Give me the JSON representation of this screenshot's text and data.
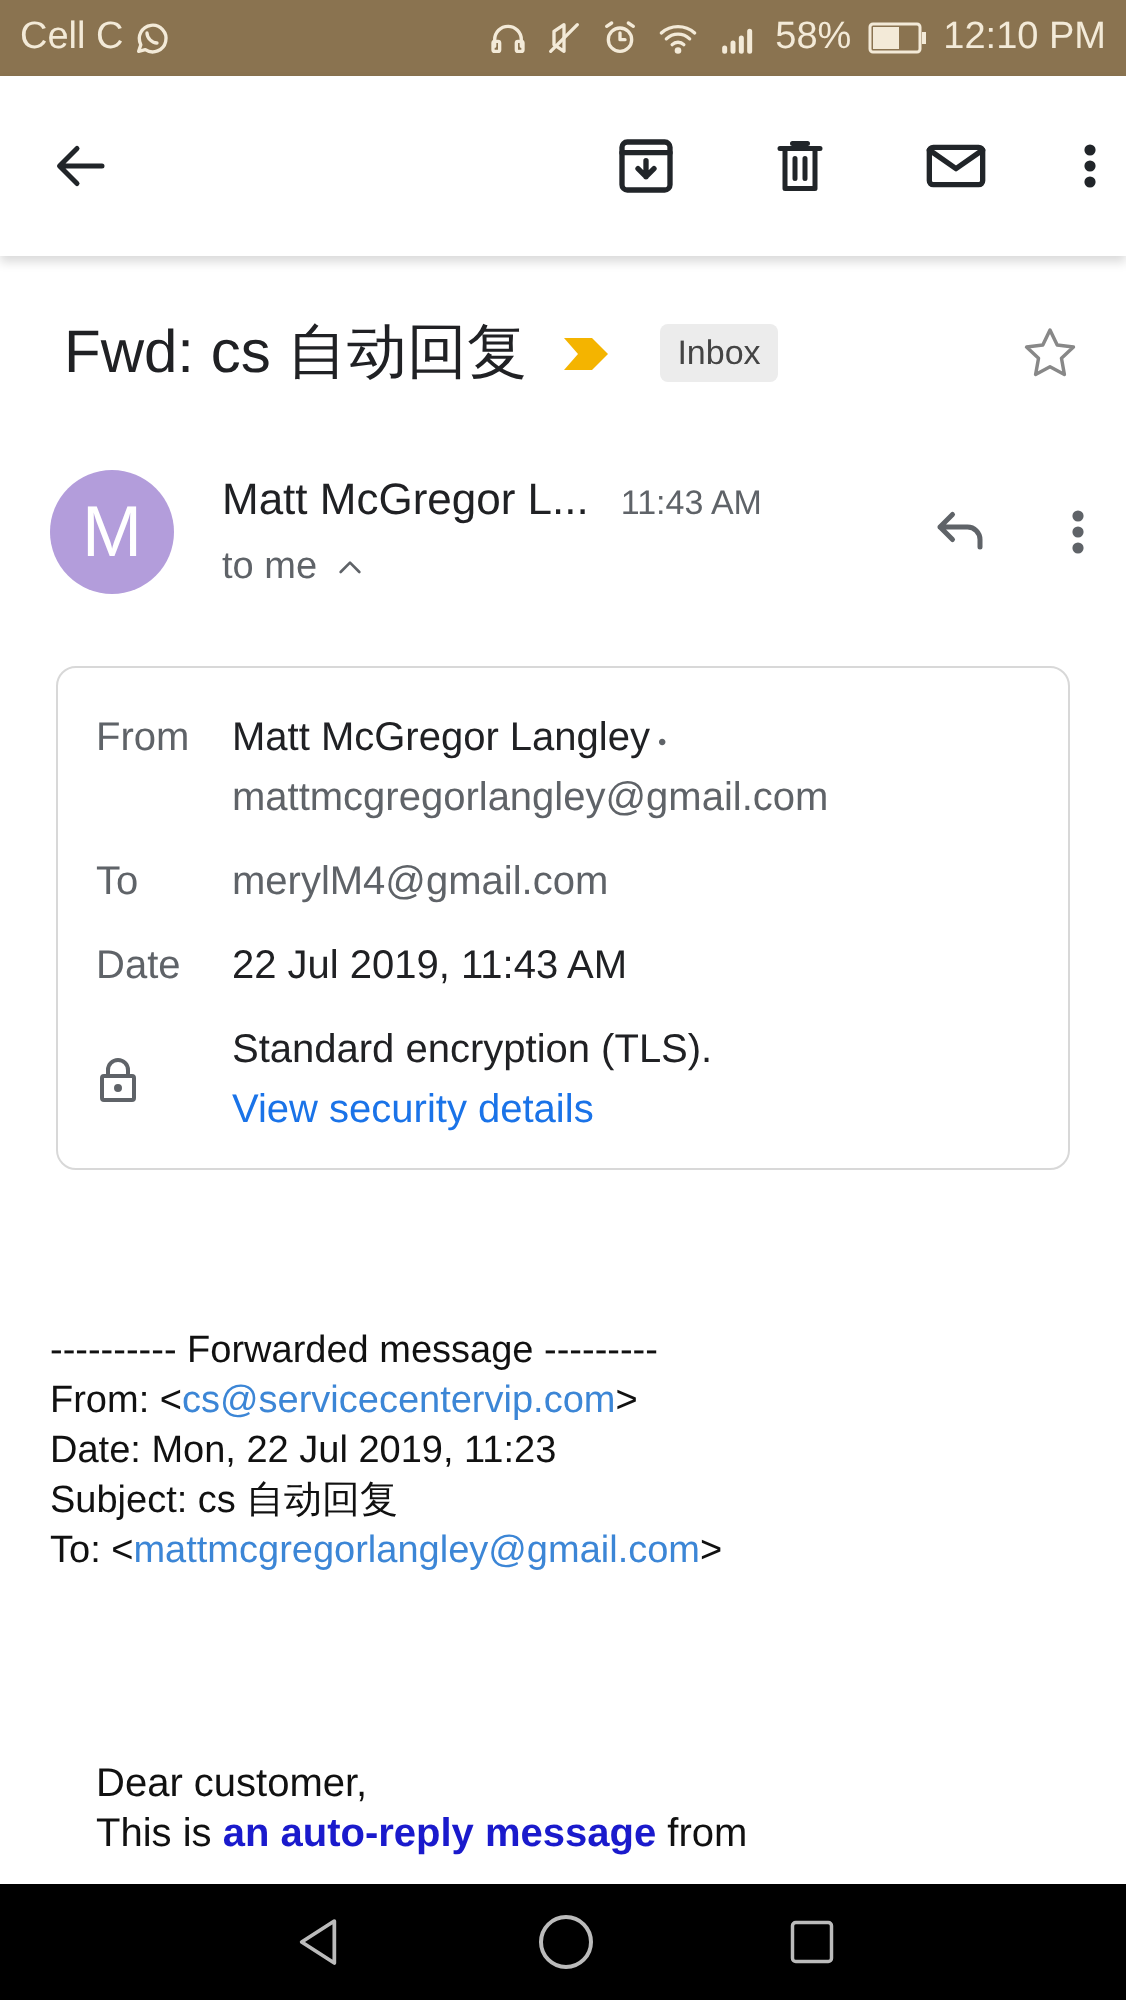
{
  "status_bar": {
    "carrier": "Cell C",
    "battery": "58%",
    "time": "12:10 PM"
  },
  "subject": {
    "title": "Fwd: cs 自动回复",
    "important": true,
    "label": "Inbox",
    "starred": false
  },
  "sender": {
    "avatar": "M",
    "name": "Matt McGregor L...",
    "time": "11:43 AM",
    "recipient": "to me",
    "details_expanded": true
  },
  "details": [
    {
      "kind": "from",
      "label": "From",
      "name": "Matt McGregor Langley",
      "separator": "•",
      "email": "mattmcgregorlangley@gmail.com"
    },
    {
      "kind": "plain",
      "label": "To",
      "value": "merylM4@gmail.com",
      "muted": true
    },
    {
      "kind": "plain",
      "label": "Date",
      "value": "22 Jul 2019, 11:43 AM",
      "muted": false
    },
    {
      "kind": "security",
      "text": "Standard encryption (TLS).",
      "link": "View security details"
    }
  ],
  "forwarded": {
    "header": "---------- Forwarded message ---------",
    "lines": [
      {
        "prefix": "From: <",
        "link": "cs@servicecentervip.com",
        "suffix": ">"
      },
      {
        "prefix": "Date: Mon, 22 Jul 2019, 11:23"
      },
      {
        "prefix": "Subject: cs 自动回复"
      },
      {
        "prefix": "To: <",
        "link": "mattmcgregorlangley@gmail.com",
        "suffix": ">"
      }
    ]
  },
  "body": [
    {
      "before": "Dear customer,"
    },
    {
      "before": "This is ",
      "link": "an auto-reply message",
      "after": " from"
    }
  ]
}
